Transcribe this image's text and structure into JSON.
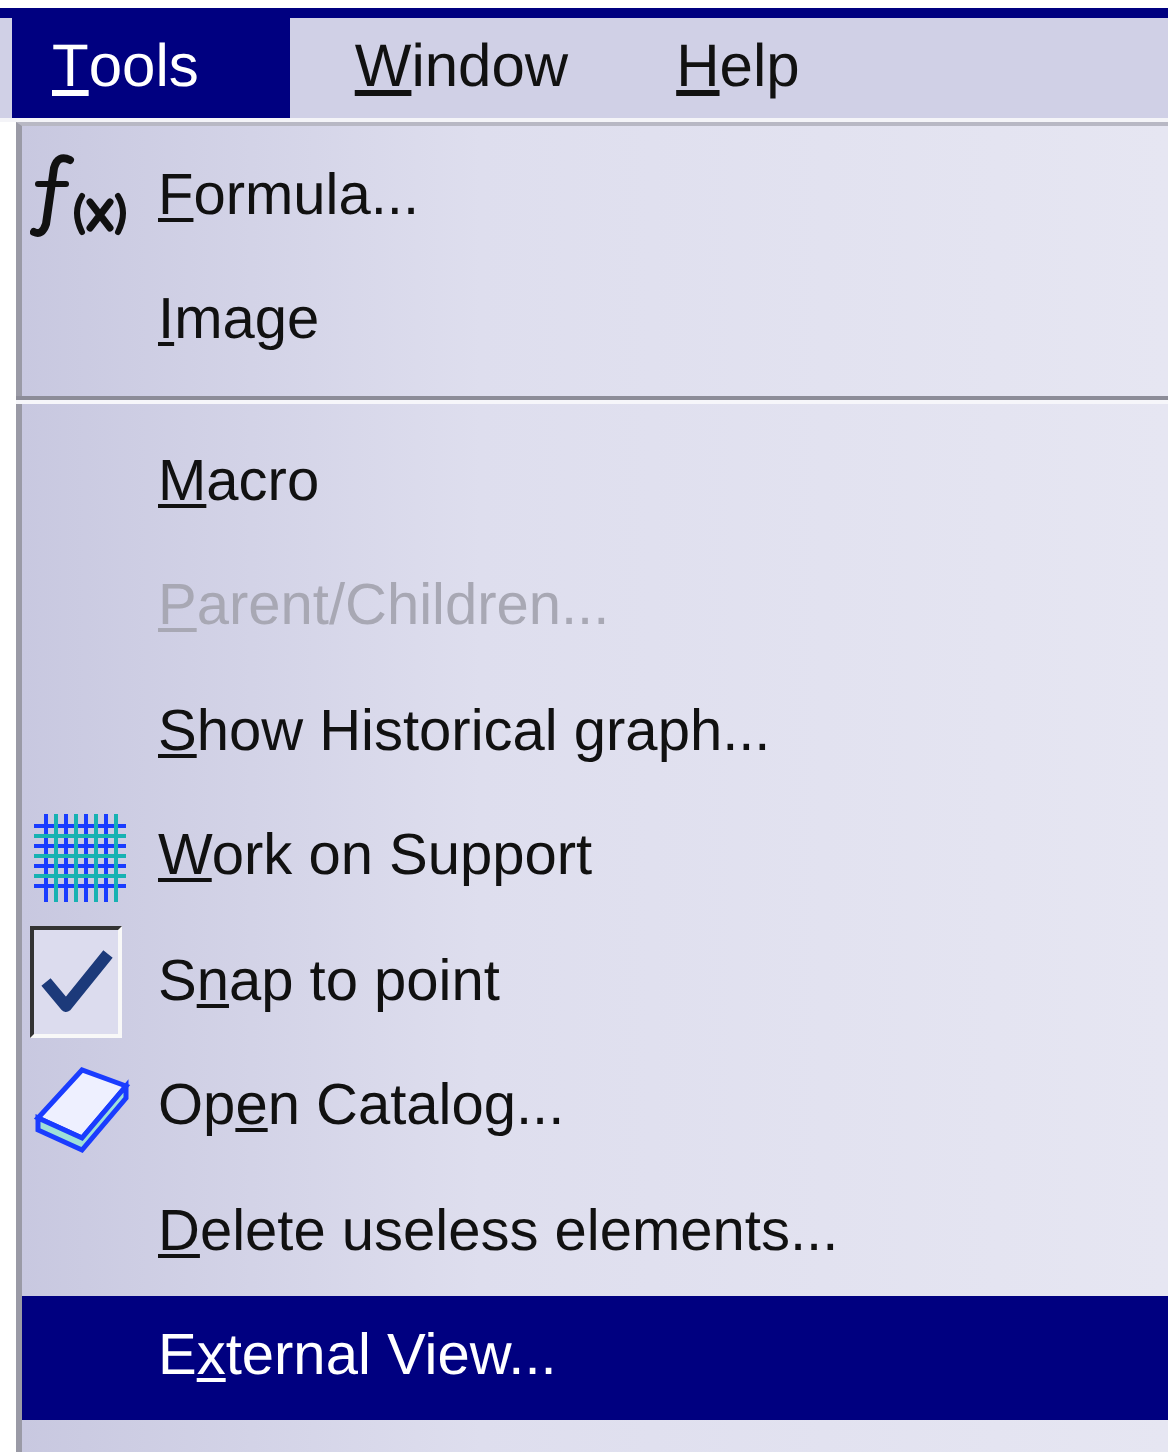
{
  "menu_bar": [
    {
      "mnemonic": "T",
      "label_rest": "ools",
      "selected": true
    },
    {
      "mnemonic": "W",
      "label_rest": "indow",
      "selected": false
    },
    {
      "mnemonic": "H",
      "label_rest": "elp",
      "selected": false
    }
  ],
  "menu": {
    "items": [
      {
        "kind": "icon-command",
        "mnemonic": "F",
        "label_rest": "ormula...",
        "disabled": false,
        "selected": false
      },
      {
        "kind": "command",
        "mnemonic": "I",
        "label_rest": "mage",
        "disabled": false,
        "selected": false
      },
      {
        "kind": "separator"
      },
      {
        "kind": "command",
        "mnemonic": "M",
        "label_rest": "acro",
        "disabled": false,
        "selected": false
      },
      {
        "kind": "command",
        "mnemonic": "P",
        "label_rest": "arent/Children...",
        "disabled": true,
        "selected": false
      },
      {
        "kind": "command",
        "mnemonic": "S",
        "label_rest": "how Historical graph...",
        "disabled": false,
        "selected": false
      },
      {
        "kind": "icon-command",
        "mnemonic": "W",
        "label_rest": "ork on Support",
        "disabled": false,
        "selected": false
      },
      {
        "kind": "toggle",
        "label_start": "S",
        "mnemonic": "n",
        "label_rest": "ap to point",
        "checked": true,
        "disabled": false,
        "selected": false
      },
      {
        "kind": "icon-command",
        "label_start": "Op",
        "mnemonic": "e",
        "label_rest": "n Catalog...",
        "disabled": false,
        "selected": false
      },
      {
        "kind": "command",
        "mnemonic": "D",
        "label_rest": "elete useless elements...",
        "disabled": false,
        "selected": false
      },
      {
        "kind": "command",
        "label_start": "E",
        "mnemonic": "x",
        "label_rest": "ternal View...",
        "disabled": false,
        "selected": true
      }
    ]
  }
}
